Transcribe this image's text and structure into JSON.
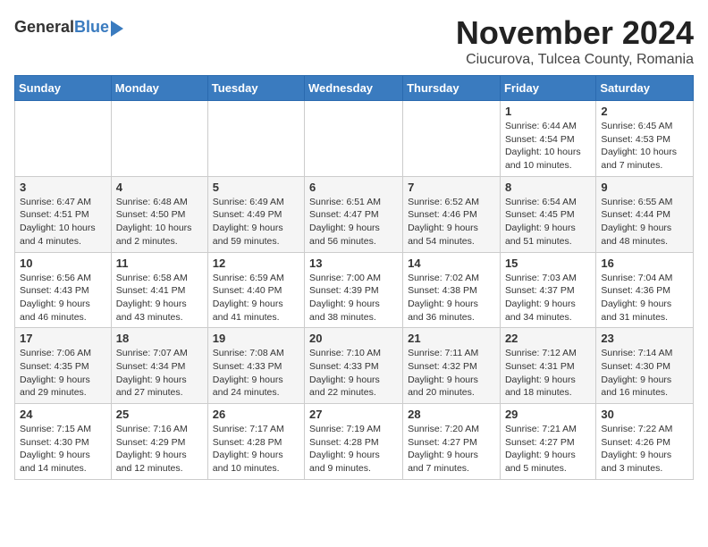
{
  "header": {
    "logo_general": "General",
    "logo_blue": "Blue",
    "month_year": "November 2024",
    "location": "Ciucurova, Tulcea County, Romania"
  },
  "weekdays": [
    "Sunday",
    "Monday",
    "Tuesday",
    "Wednesday",
    "Thursday",
    "Friday",
    "Saturday"
  ],
  "weeks": [
    [
      {
        "day": "",
        "info": ""
      },
      {
        "day": "",
        "info": ""
      },
      {
        "day": "",
        "info": ""
      },
      {
        "day": "",
        "info": ""
      },
      {
        "day": "",
        "info": ""
      },
      {
        "day": "1",
        "info": "Sunrise: 6:44 AM\nSunset: 4:54 PM\nDaylight: 10 hours\nand 10 minutes."
      },
      {
        "day": "2",
        "info": "Sunrise: 6:45 AM\nSunset: 4:53 PM\nDaylight: 10 hours\nand 7 minutes."
      }
    ],
    [
      {
        "day": "3",
        "info": "Sunrise: 6:47 AM\nSunset: 4:51 PM\nDaylight: 10 hours\nand 4 minutes."
      },
      {
        "day": "4",
        "info": "Sunrise: 6:48 AM\nSunset: 4:50 PM\nDaylight: 10 hours\nand 2 minutes."
      },
      {
        "day": "5",
        "info": "Sunrise: 6:49 AM\nSunset: 4:49 PM\nDaylight: 9 hours\nand 59 minutes."
      },
      {
        "day": "6",
        "info": "Sunrise: 6:51 AM\nSunset: 4:47 PM\nDaylight: 9 hours\nand 56 minutes."
      },
      {
        "day": "7",
        "info": "Sunrise: 6:52 AM\nSunset: 4:46 PM\nDaylight: 9 hours\nand 54 minutes."
      },
      {
        "day": "8",
        "info": "Sunrise: 6:54 AM\nSunset: 4:45 PM\nDaylight: 9 hours\nand 51 minutes."
      },
      {
        "day": "9",
        "info": "Sunrise: 6:55 AM\nSunset: 4:44 PM\nDaylight: 9 hours\nand 48 minutes."
      }
    ],
    [
      {
        "day": "10",
        "info": "Sunrise: 6:56 AM\nSunset: 4:43 PM\nDaylight: 9 hours\nand 46 minutes."
      },
      {
        "day": "11",
        "info": "Sunrise: 6:58 AM\nSunset: 4:41 PM\nDaylight: 9 hours\nand 43 minutes."
      },
      {
        "day": "12",
        "info": "Sunrise: 6:59 AM\nSunset: 4:40 PM\nDaylight: 9 hours\nand 41 minutes."
      },
      {
        "day": "13",
        "info": "Sunrise: 7:00 AM\nSunset: 4:39 PM\nDaylight: 9 hours\nand 38 minutes."
      },
      {
        "day": "14",
        "info": "Sunrise: 7:02 AM\nSunset: 4:38 PM\nDaylight: 9 hours\nand 36 minutes."
      },
      {
        "day": "15",
        "info": "Sunrise: 7:03 AM\nSunset: 4:37 PM\nDaylight: 9 hours\nand 34 minutes."
      },
      {
        "day": "16",
        "info": "Sunrise: 7:04 AM\nSunset: 4:36 PM\nDaylight: 9 hours\nand 31 minutes."
      }
    ],
    [
      {
        "day": "17",
        "info": "Sunrise: 7:06 AM\nSunset: 4:35 PM\nDaylight: 9 hours\nand 29 minutes."
      },
      {
        "day": "18",
        "info": "Sunrise: 7:07 AM\nSunset: 4:34 PM\nDaylight: 9 hours\nand 27 minutes."
      },
      {
        "day": "19",
        "info": "Sunrise: 7:08 AM\nSunset: 4:33 PM\nDaylight: 9 hours\nand 24 minutes."
      },
      {
        "day": "20",
        "info": "Sunrise: 7:10 AM\nSunset: 4:33 PM\nDaylight: 9 hours\nand 22 minutes."
      },
      {
        "day": "21",
        "info": "Sunrise: 7:11 AM\nSunset: 4:32 PM\nDaylight: 9 hours\nand 20 minutes."
      },
      {
        "day": "22",
        "info": "Sunrise: 7:12 AM\nSunset: 4:31 PM\nDaylight: 9 hours\nand 18 minutes."
      },
      {
        "day": "23",
        "info": "Sunrise: 7:14 AM\nSunset: 4:30 PM\nDaylight: 9 hours\nand 16 minutes."
      }
    ],
    [
      {
        "day": "24",
        "info": "Sunrise: 7:15 AM\nSunset: 4:30 PM\nDaylight: 9 hours\nand 14 minutes."
      },
      {
        "day": "25",
        "info": "Sunrise: 7:16 AM\nSunset: 4:29 PM\nDaylight: 9 hours\nand 12 minutes."
      },
      {
        "day": "26",
        "info": "Sunrise: 7:17 AM\nSunset: 4:28 PM\nDaylight: 9 hours\nand 10 minutes."
      },
      {
        "day": "27",
        "info": "Sunrise: 7:19 AM\nSunset: 4:28 PM\nDaylight: 9 hours\nand 9 minutes."
      },
      {
        "day": "28",
        "info": "Sunrise: 7:20 AM\nSunset: 4:27 PM\nDaylight: 9 hours\nand 7 minutes."
      },
      {
        "day": "29",
        "info": "Sunrise: 7:21 AM\nSunset: 4:27 PM\nDaylight: 9 hours\nand 5 minutes."
      },
      {
        "day": "30",
        "info": "Sunrise: 7:22 AM\nSunset: 4:26 PM\nDaylight: 9 hours\nand 3 minutes."
      }
    ]
  ]
}
